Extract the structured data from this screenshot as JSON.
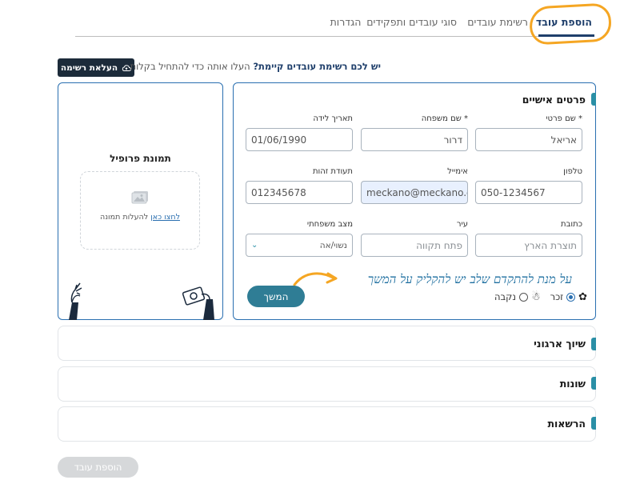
{
  "tabs": [
    {
      "label": "הוספת עובד",
      "active": true
    },
    {
      "label": "רשימת עובדים",
      "active": false
    },
    {
      "label": "סוגי עובדים ותפקידים",
      "active": false
    },
    {
      "label": "הגדרות",
      "active": false
    }
  ],
  "upload": {
    "button_label": "העלאת רשימה",
    "prompt_bold": "יש לכם רשימת עובדים קיימת?",
    "prompt_rest": " העלו אותה כדי להתחיל בקלות"
  },
  "profile": {
    "title": "תמונת פרופיל",
    "link": "לחצו כאן",
    "link_rest": " להעלות תמונה"
  },
  "personal": {
    "title": "פרטים אישיים",
    "fields": {
      "first_name": {
        "label": "* שם פרטי",
        "value": "אריאל"
      },
      "last_name": {
        "label": "* שם משפחה",
        "value": "דרור"
      },
      "birth_date": {
        "label": "תאריך לידה",
        "value": "01/06/1990"
      },
      "phone": {
        "label": "טלפון",
        "value": "050-1234567"
      },
      "email": {
        "label": "אימייל",
        "value": "meckano@meckano.co"
      },
      "id_number": {
        "label": "תעודת זהות",
        "value": "012345678"
      },
      "address": {
        "label": "כתובת",
        "placeholder": "תוצרת הארץ"
      },
      "city": {
        "label": "עיר",
        "placeholder": "פתח תקווה"
      },
      "marital": {
        "label": "מצב משפחתי",
        "value": "נשוי/אה"
      }
    },
    "gender": {
      "male": "זכר",
      "female": "נקבה",
      "selected": "male"
    },
    "continue_label": "המשך",
    "annotation": "על מנת להתקדם שלב יש להקליק על המשך"
  },
  "sections": [
    {
      "title": "שיוך ארגוני"
    },
    {
      "title": "שונות"
    },
    {
      "title": "הרשאות"
    }
  ],
  "footer": {
    "add_button": "הוספת עובד"
  },
  "colors": {
    "primary": "#1f3f6b",
    "accent": "#2a8fa6",
    "border": "#2a6fb0",
    "highlight": "#f5a623"
  }
}
